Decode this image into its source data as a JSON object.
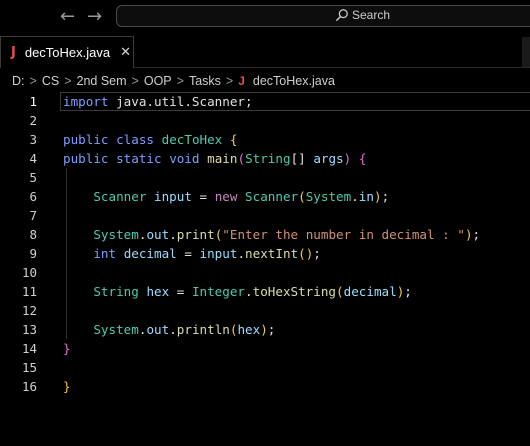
{
  "titlebar": {
    "back_icon": "arrow-left-icon",
    "forward_icon": "arrow-right-icon",
    "search_label": "Search"
  },
  "tab": {
    "icon_letter": "J",
    "label": "decToHex.java",
    "close_glyph": "✕"
  },
  "breadcrumb": {
    "items": [
      "D:",
      "CS",
      "2nd Sem",
      "OOP",
      "Tasks"
    ],
    "file_icon_letter": "J",
    "file": "decToHex.java",
    "separator": ">"
  },
  "colors": {
    "background": "#000000",
    "java_icon": "#f04a4a",
    "keyword": "#c586c0",
    "type": "#4ec9b0",
    "string": "#ce9178",
    "function": "#dcdcaa",
    "variable": "#9cdcfe",
    "brace": "#f2c94c"
  },
  "editor": {
    "active_line": 1,
    "lines": [
      {
        "n": "1",
        "tokens": [
          [
            "kw2",
            "import"
          ],
          [
            "plain",
            " java.util.Scanner;"
          ]
        ]
      },
      {
        "n": "2",
        "tokens": []
      },
      {
        "n": "3",
        "tokens": [
          [
            "kw2",
            "public"
          ],
          [
            "plain",
            " "
          ],
          [
            "kw2",
            "class"
          ],
          [
            "plain",
            " "
          ],
          [
            "ty",
            "decToHex"
          ],
          [
            "plain",
            " "
          ],
          [
            "brace",
            "{"
          ]
        ]
      },
      {
        "n": "4",
        "tokens": [
          [
            "kw2",
            "public"
          ],
          [
            "plain",
            " "
          ],
          [
            "kw2",
            "static"
          ],
          [
            "plain",
            " "
          ],
          [
            "kw2",
            "void"
          ],
          [
            "plain",
            " "
          ],
          [
            "fn",
            "main"
          ],
          [
            "paren",
            "("
          ],
          [
            "ty",
            "String"
          ],
          [
            "plain",
            "[] "
          ],
          [
            "var",
            "args"
          ],
          [
            "paren",
            ")"
          ],
          [
            "plain",
            " "
          ],
          [
            "paren",
            "{"
          ]
        ]
      },
      {
        "n": "5",
        "tokens": []
      },
      {
        "n": "6",
        "tokens": [
          [
            "plain",
            "    "
          ],
          [
            "ty",
            "Scanner"
          ],
          [
            "plain",
            " "
          ],
          [
            "var",
            "input"
          ],
          [
            "plain",
            " = "
          ],
          [
            "kw",
            "new"
          ],
          [
            "plain",
            " "
          ],
          [
            "ty",
            "Scanner"
          ],
          [
            "brace",
            "("
          ],
          [
            "ty",
            "System"
          ],
          [
            "plain",
            "."
          ],
          [
            "var",
            "in"
          ],
          [
            "brace",
            ")"
          ],
          [
            "plain",
            ";"
          ]
        ]
      },
      {
        "n": "7",
        "tokens": []
      },
      {
        "n": "8",
        "tokens": [
          [
            "plain",
            "    "
          ],
          [
            "ty",
            "System"
          ],
          [
            "plain",
            "."
          ],
          [
            "var",
            "out"
          ],
          [
            "plain",
            "."
          ],
          [
            "fn",
            "print"
          ],
          [
            "brace",
            "("
          ],
          [
            "str",
            "\"Enter the number in decimal : \""
          ],
          [
            "brace",
            ")"
          ],
          [
            "plain",
            ";"
          ]
        ]
      },
      {
        "n": "9",
        "tokens": [
          [
            "plain",
            "    "
          ],
          [
            "kw2",
            "int"
          ],
          [
            "plain",
            " "
          ],
          [
            "var",
            "decimal"
          ],
          [
            "plain",
            " = "
          ],
          [
            "var",
            "input"
          ],
          [
            "plain",
            "."
          ],
          [
            "fn",
            "nextInt"
          ],
          [
            "brace",
            "()"
          ],
          [
            "plain",
            ";"
          ]
        ]
      },
      {
        "n": "10",
        "tokens": []
      },
      {
        "n": "11",
        "tokens": [
          [
            "plain",
            "    "
          ],
          [
            "ty",
            "String"
          ],
          [
            "plain",
            " "
          ],
          [
            "var",
            "hex"
          ],
          [
            "plain",
            " = "
          ],
          [
            "ty",
            "Integer"
          ],
          [
            "plain",
            "."
          ],
          [
            "fn",
            "toHexString"
          ],
          [
            "brace",
            "("
          ],
          [
            "var",
            "decimal"
          ],
          [
            "brace",
            ")"
          ],
          [
            "plain",
            ";"
          ]
        ]
      },
      {
        "n": "12",
        "tokens": []
      },
      {
        "n": "13",
        "tokens": [
          [
            "plain",
            "    "
          ],
          [
            "ty",
            "System"
          ],
          [
            "plain",
            "."
          ],
          [
            "var",
            "out"
          ],
          [
            "plain",
            "."
          ],
          [
            "fn",
            "println"
          ],
          [
            "brace",
            "("
          ],
          [
            "var",
            "hex"
          ],
          [
            "brace",
            ")"
          ],
          [
            "plain",
            ";"
          ]
        ]
      },
      {
        "n": "14",
        "tokens": [
          [
            "paren",
            "}"
          ]
        ]
      },
      {
        "n": "15",
        "tokens": []
      },
      {
        "n": "16",
        "tokens": [
          [
            "brace",
            "}"
          ]
        ]
      }
    ]
  }
}
